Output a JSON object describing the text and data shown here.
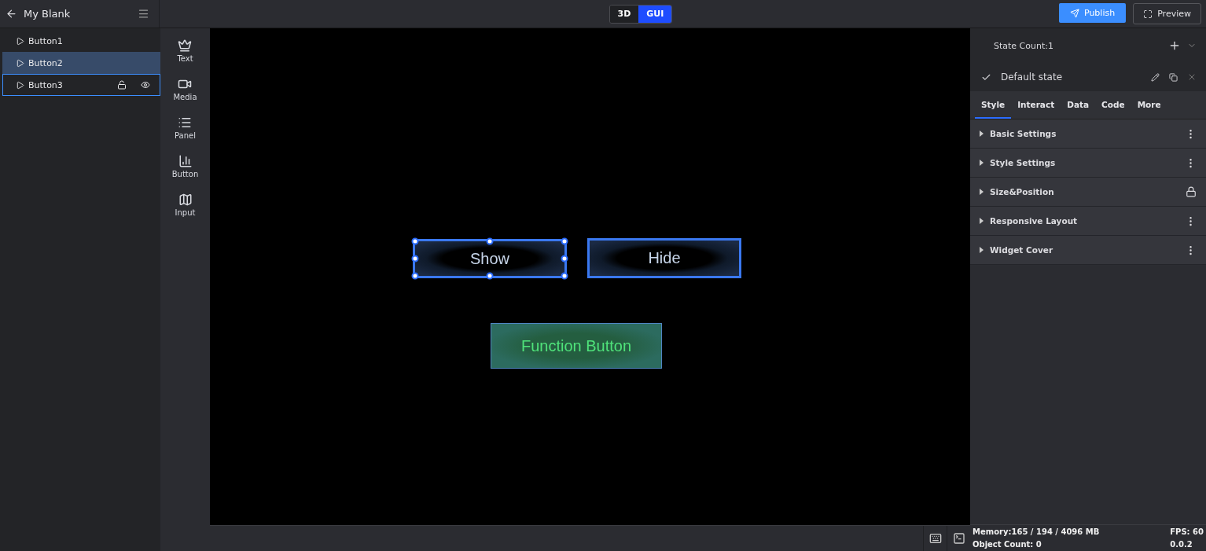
{
  "project": {
    "title": "My Blank"
  },
  "mode_toggle": [
    {
      "label": "3D",
      "selected": false
    },
    {
      "label": "GUI",
      "selected": true
    }
  ],
  "actions": {
    "publish": "Publish",
    "preview": "Preview"
  },
  "layers": [
    {
      "label": "Button1",
      "selected": false,
      "focused": false
    },
    {
      "label": "Button2",
      "selected": true,
      "focused": false
    },
    {
      "label": "Button3",
      "selected": false,
      "focused": true
    }
  ],
  "toolbox": [
    {
      "label": "Text",
      "kind": "text"
    },
    {
      "label": "Media",
      "kind": "media"
    },
    {
      "label": "Panel",
      "kind": "panel"
    },
    {
      "label": "Button",
      "kind": "button"
    },
    {
      "label": "Input",
      "kind": "input"
    }
  ],
  "canvas_widgets": [
    {
      "label": "Show",
      "kind": "dark",
      "selected": true,
      "hovered": false
    },
    {
      "label": "Hide",
      "kind": "dark",
      "selected": false,
      "hovered": true
    },
    {
      "label": "Function Button",
      "kind": "function",
      "selected": false,
      "hovered": false
    }
  ],
  "state_panel": {
    "count": "State Count:1",
    "state": "Default state"
  },
  "tabs": [
    {
      "label": "Style",
      "selected": true
    },
    {
      "label": "Interact",
      "selected": false
    },
    {
      "label": "Data",
      "selected": false
    },
    {
      "label": "Code",
      "selected": false
    },
    {
      "label": "More",
      "selected": false
    }
  ],
  "sections": [
    {
      "label": "Basic Settings",
      "expanded": false,
      "kind": "menu"
    },
    {
      "label": "Style Settings",
      "expanded": false,
      "kind": "menu"
    },
    {
      "label": "Size&Position",
      "expanded": false,
      "kind": "lock"
    },
    {
      "label": "Responsive Layout",
      "expanded": false,
      "kind": "menu"
    },
    {
      "label": "Widget Cover",
      "expanded": false,
      "kind": "menu"
    }
  ],
  "status_bar": {
    "memory": "Memory:165 / 194 / 4096 MB",
    "fps": "FPS: 60",
    "objects": "Object Count: 0",
    "version": "0.0.2"
  }
}
